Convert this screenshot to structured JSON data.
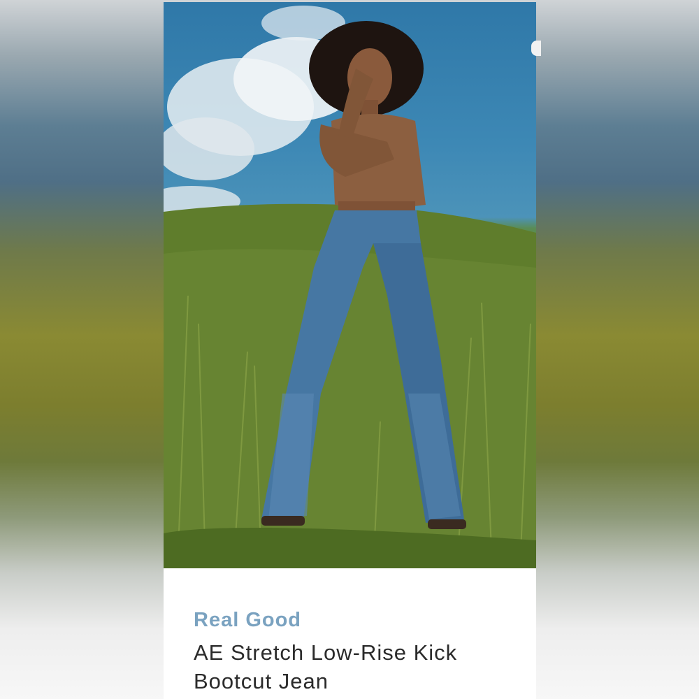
{
  "listing": {
    "brand": "Real Good",
    "product_title": "AE Stretch Low-Rise Kick Bootcut Jean"
  },
  "photo": {
    "alt": "Model in brown long-sleeve top and blue low-rise bootcut jeans standing in tall grass under a blue sky"
  },
  "colors": {
    "brand_text": "#7aa2c0",
    "title_text": "#2b2b2b",
    "card_background": "#ffffff"
  }
}
